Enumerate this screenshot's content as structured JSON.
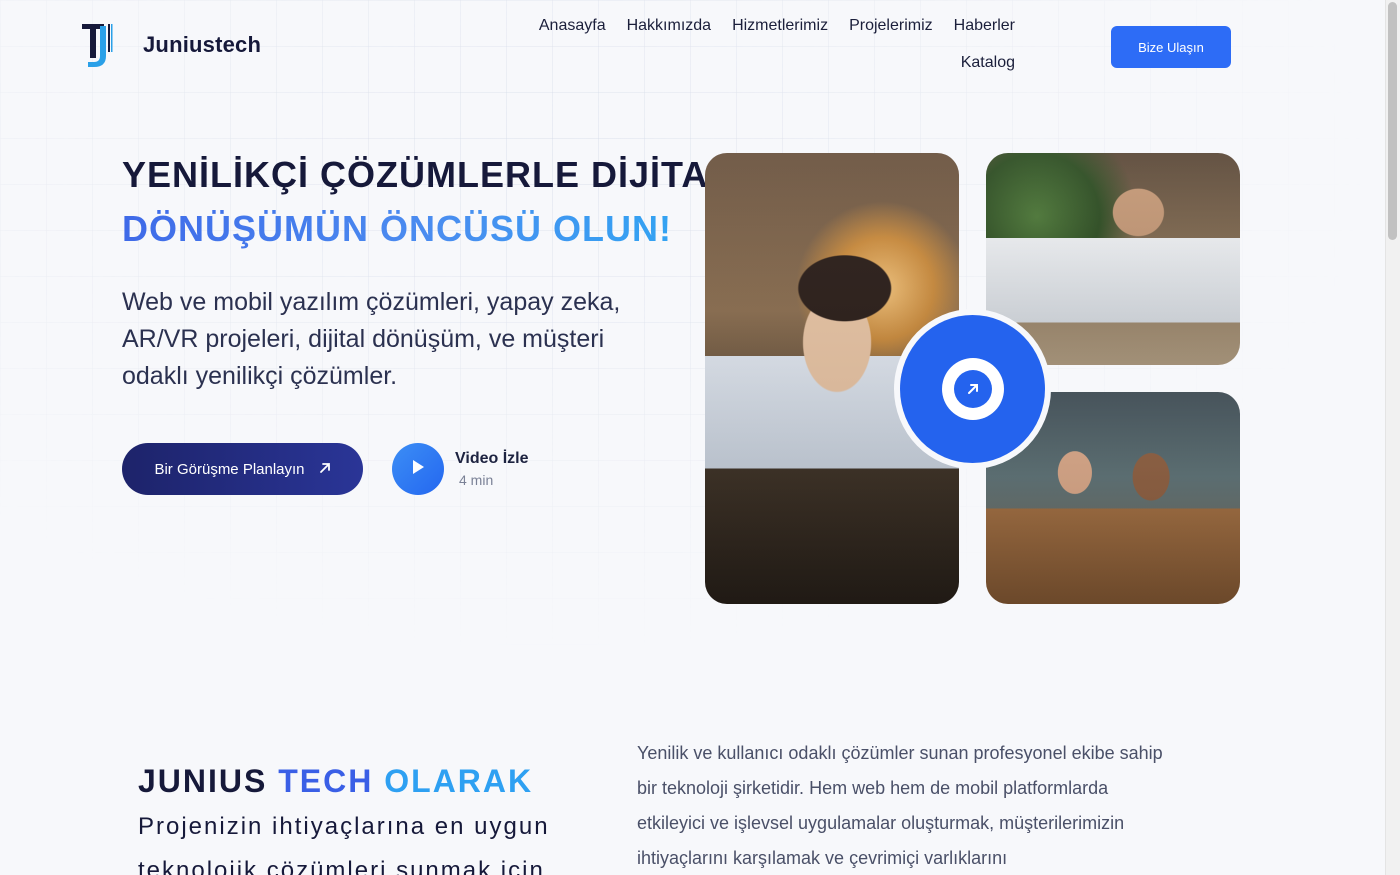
{
  "header": {
    "brand": "Juniustech",
    "nav_row1": [
      "Anasayfa",
      "Hakkımızda",
      "Hizmetlerimiz",
      "Projelerimiz",
      "Haberler"
    ],
    "nav_row2": [
      "Katalog"
    ],
    "cta_label": "Bize Ulaşın"
  },
  "hero": {
    "title_line1": "YENİLİKÇİ ÇÖZÜMLERLE DİJİTAL",
    "title_line2": "DÖNÜŞÜMÜN ÖNCÜSÜ OLUN!",
    "subtitle": "Web ve mobil yazılım çözümleri, yapay zeka, AR/VR projeleri, dijital dönüşüm, ve müşteri odaklı yenilikçi çözümler.",
    "primary_button": "Bir Görüşme Planlayın",
    "video_title": "Video İzle",
    "video_length": "4 min"
  },
  "about": {
    "title_word1": "JUNIUS",
    "title_word2": "TECH",
    "title_word3": "OLARAK",
    "subtitle": "Projenizin ihtiyaçlarına en uygun teknolojik çözümleri sunmak için",
    "text": "Yenilik ve kullanıcı odaklı çözümler sunan profesyonel ekibe sahip bir teknoloji şirketidir. Hem web hem de mobil platformlarda etkileyici ve işlevsel uygulamalar oluşturmak, müşterilerimizin ihtiyaçlarını karşılamak ve çevrimiçi varlıklarını"
  },
  "colors": {
    "accent": "#2d6cf6",
    "navy": "#16193a",
    "gradient_blue": "#3f6ae8",
    "light_blue": "#2ea0f2"
  },
  "icons": {
    "primary_button_icon": "arrow-up-right-icon",
    "video_icon": "play-icon",
    "center_icon": "arrow-up-right-icon"
  }
}
